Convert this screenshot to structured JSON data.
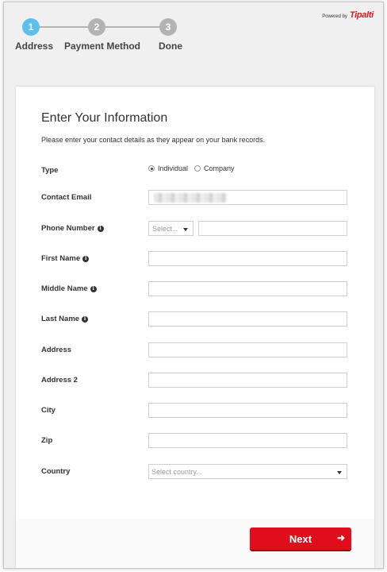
{
  "stepper": {
    "steps": [
      {
        "number": "1",
        "label": "Address",
        "active": true
      },
      {
        "number": "2",
        "label": "Payment Method",
        "active": false
      },
      {
        "number": "3",
        "label": "Done",
        "active": false
      }
    ],
    "powered_by": "Powered by",
    "brand": "Tipalti"
  },
  "form": {
    "title": "Enter Your Information",
    "description": "Please enter your contact details as they appear on your bank records.",
    "type_label": "Type",
    "type_options": [
      "Individual",
      "Company"
    ],
    "type_selected": "Individual",
    "contact_email_label": "Contact Email",
    "phone_label": "Phone Number",
    "phone_select_placeholder": "Select...",
    "first_name_label": "First Name",
    "middle_name_label": "Middle Name",
    "last_name_label": "Last Name",
    "address_label": "Address",
    "address2_label": "Address 2",
    "city_label": "City",
    "zip_label": "Zip",
    "country_label": "Country",
    "country_placeholder": "Select country...",
    "info_icon_glyph": "i"
  },
  "footer": {
    "next_label": "Next",
    "next_arrow": "➜"
  },
  "colors": {
    "accent_active_step": "#5bc0eb",
    "inactive_step": "#b3b3b3",
    "next_button": "#e00d1c",
    "brand_red": "#e0181f"
  }
}
